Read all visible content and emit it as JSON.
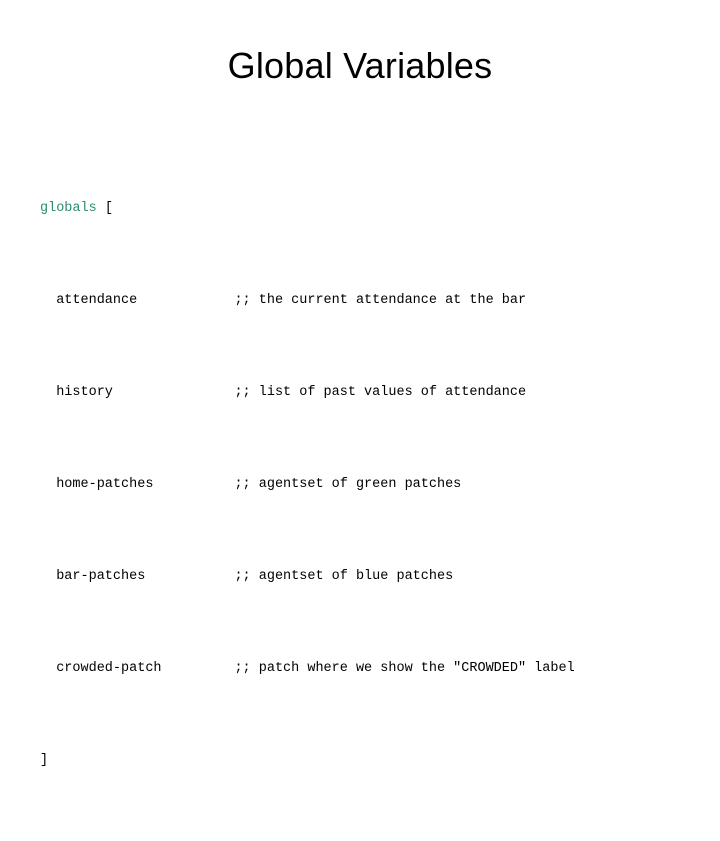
{
  "slide": {
    "title": "Global Variables",
    "background_color": "#ffffff",
    "text_color": "#000000",
    "keyword_color": "#2e8b73"
  },
  "code": {
    "language": "NetLogo",
    "open_line": {
      "keyword": "globals",
      "space": " ",
      "bracket": "["
    },
    "close_line": {
      "bracket": "]"
    },
    "indent": "  ",
    "comment_column": 24,
    "comment_prefix": ";;",
    "entries": [
      {
        "name": "attendance",
        "comment": "the current attendance at the bar"
      },
      {
        "name": "history",
        "comment": "list of past values of attendance"
      },
      {
        "name": "home-patches",
        "comment": "agentset of green patches"
      },
      {
        "name": "bar-patches",
        "comment": "agentset of blue patches"
      },
      {
        "name": "crowded-patch",
        "comment": "patch where we show the \"CROWDED\" label"
      }
    ]
  }
}
